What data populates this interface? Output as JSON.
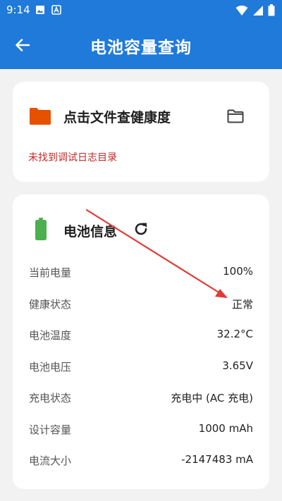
{
  "statusbar": {
    "time": "9:14"
  },
  "appbar": {
    "title": "电池容量查询"
  },
  "file_card": {
    "label": "点击文件查健康度",
    "error": "未找到调试日志目录"
  },
  "battery_card": {
    "label": "电池信息",
    "rows": [
      {
        "key": "当前电量",
        "value": "100%"
      },
      {
        "key": "健康状态",
        "value": "正常"
      },
      {
        "key": "电池温度",
        "value": "32.2°C"
      },
      {
        "key": "电池电压",
        "value": "3.65V"
      },
      {
        "key": "充电状态",
        "value": "充电中 (AC 充电)"
      },
      {
        "key": "设计容量",
        "value": "1000 mAh"
      },
      {
        "key": "电流大小",
        "value": "-2147483 mA"
      }
    ]
  },
  "colors": {
    "primary": "#1f7ad9",
    "folder": "#e65100",
    "battery": "#4caf50",
    "error": "#c62828",
    "annotation": "#e53935"
  }
}
